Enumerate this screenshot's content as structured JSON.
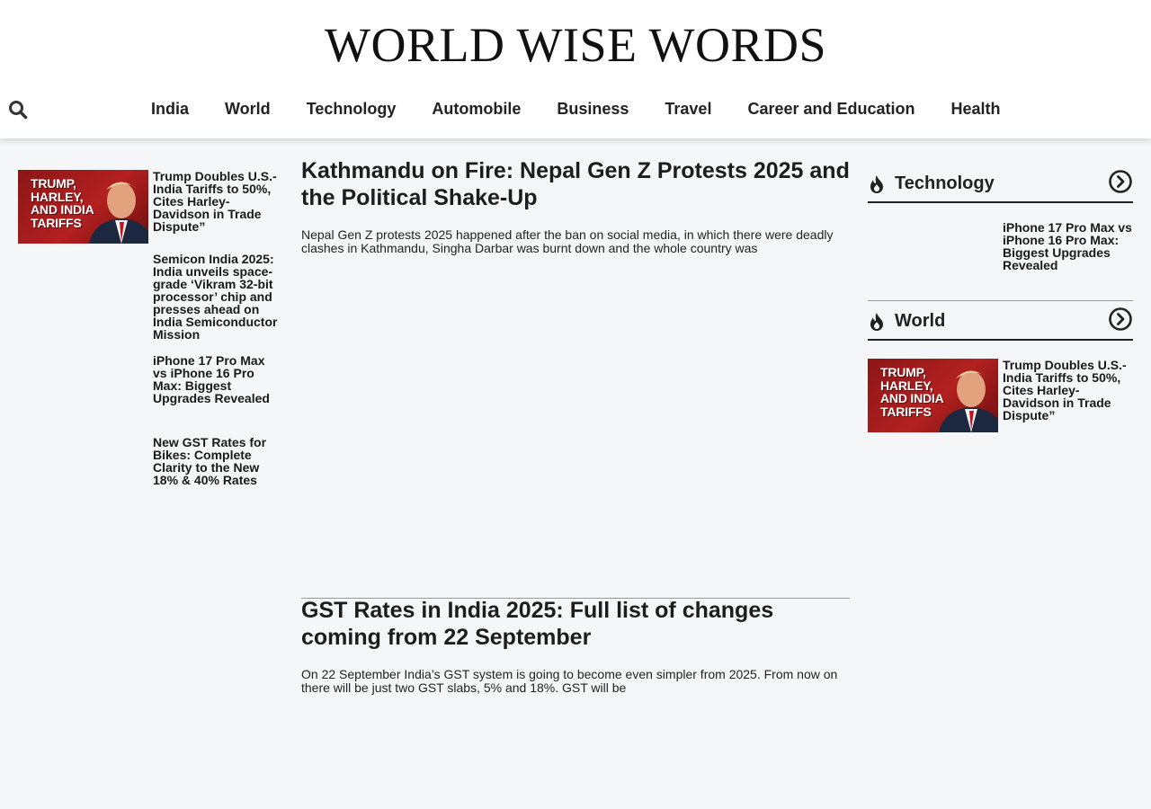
{
  "site": {
    "logo": "WORLD WISE WORDS"
  },
  "nav": {
    "items": [
      "India",
      "World",
      "Technology",
      "Automobile",
      "Business",
      "Travel",
      "Career and Education",
      "Health"
    ]
  },
  "left_posts": [
    {
      "title": "Trump Doubles U.S.-India Tariffs to 50%, Cites Harley-Davidson in Trade Dispute”",
      "thumb_text": "TRUMP,\nHARLEY,\nAND INDIA\nTARIFFS"
    },
    {
      "title": "Semicon India 2025: India unveils space-grade ‘Vikram 32-bit processor’ chip and presses ahead on India Semiconductor Mission"
    },
    {
      "title": "iPhone 17 Pro Max vs iPhone 16 Pro Max: Biggest Upgrades Revealed"
    },
    {
      "title": "New GST Rates for Bikes: Complete Clarity to the New 18% & 40% Rates"
    }
  ],
  "main_posts": [
    {
      "title": "Kathmandu on Fire: Nepal Gen Z Protests 2025 and the Political Shake-Up",
      "excerpt": "Nepal Gen Z protests 2025 happened after the ban on social media, in which there were deadly clashes in Kathmandu, Singha Darbar was burnt down and the whole country was"
    },
    {
      "title": "GST Rates in India 2025: Full list of changes coming from 22 September",
      "excerpt": "On 22 September India’s GST system is going to become even simpler from 2025. From now on there will be just two GST slabs, 5% and 18%. GST will be"
    }
  ],
  "widgets": [
    {
      "title": "Technology",
      "post_title": "iPhone 17 Pro Max vs iPhone 16 Pro Max: Biggest Upgrades Revealed"
    },
    {
      "title": "World",
      "post_title": "Trump Doubles U.S.-India Tariffs to 50%, Cites Harley-Davidson in Trade Dispute”",
      "thumb_text": "TRUMP,\nHARLEY,\nAND INDIA\nTARIFFS"
    }
  ],
  "icons": {
    "search": "search-icon",
    "fire": "fire-icon",
    "arrow": "chevron-right-circle-icon"
  }
}
